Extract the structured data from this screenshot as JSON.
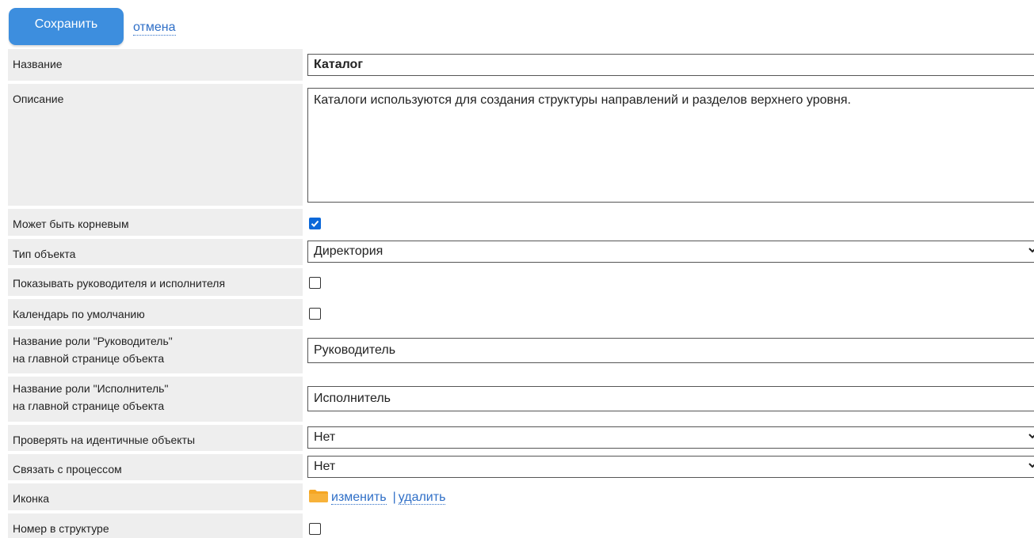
{
  "toolbar": {
    "save_label": "Сохранить",
    "cancel_label": "отмена"
  },
  "form": {
    "name": {
      "label": "Название",
      "value": "Каталог"
    },
    "description": {
      "label": "Описание",
      "value": "Каталоги используются для создания структуры направлений и разделов верхнего уровня."
    },
    "can_be_root": {
      "label": "Может быть корневым",
      "checked": true
    },
    "object_type": {
      "label": "Тип объекта",
      "value": "Директория"
    },
    "show_manager": {
      "label": "Показывать руководителя и исполнителя",
      "checked": false
    },
    "default_calendar": {
      "label": "Календарь по умолчанию",
      "checked": false
    },
    "manager_role": {
      "label_line1": "Название роли \"Руководитель\"",
      "label_line2": "на главной странице объекта",
      "value": "Руководитель"
    },
    "executor_role": {
      "label_line1": "Название роли \"Исполнитель\"",
      "label_line2": "на главной странице объекта",
      "value": "Исполнитель"
    },
    "check_identical": {
      "label": "Проверять на идентичные объекты",
      "value": "Нет"
    },
    "link_process": {
      "label": "Связать с процессом",
      "value": "Нет"
    },
    "icon": {
      "label": "Иконка",
      "change_label": "изменить",
      "delete_label": "удалить"
    },
    "structure_number": {
      "label": "Номер в структуре",
      "checked": false
    }
  },
  "colors": {
    "accent": "#3d8ede",
    "link": "#2f6fc7",
    "label_bg": "#eeeeee",
    "checkbox": "#0b68d9",
    "folder": "#f5a623"
  }
}
